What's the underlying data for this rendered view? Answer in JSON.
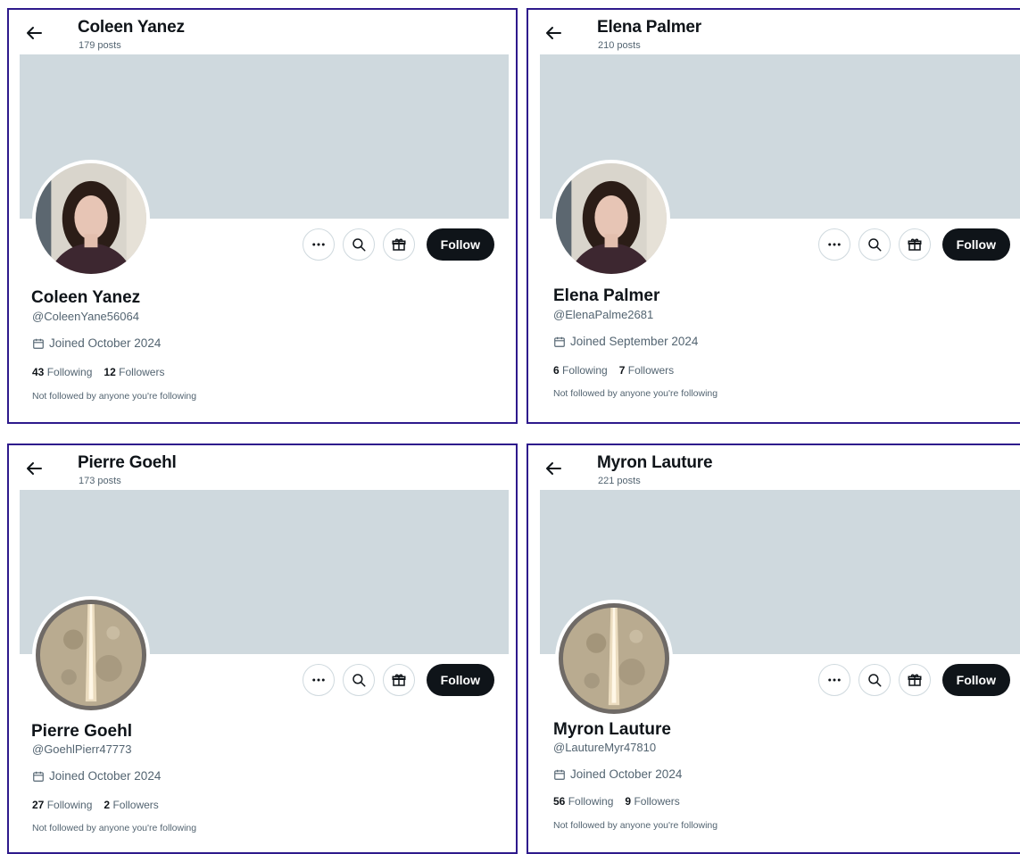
{
  "profiles": [
    {
      "header_name": "Coleen Yanez",
      "posts": "179 posts",
      "avatar_icon": "woman-portrait",
      "display_name": "Coleen Yanez",
      "handle": "@ColeenYane56064",
      "joined": "Joined October 2024",
      "following_count": "43",
      "following_label": "Following",
      "followers_count": "12",
      "followers_label": "Followers",
      "note": "Not followed by anyone you're following",
      "follow_label": "Follow"
    },
    {
      "header_name": "Elena Palmer",
      "posts": "210 posts",
      "avatar_icon": "woman-portrait",
      "display_name": "Elena Palmer",
      "handle": "@ElenaPalme2681",
      "joined": "Joined September 2024",
      "following_count": "6",
      "following_label": "Following",
      "followers_count": "7",
      "followers_label": "Followers",
      "note": "Not followed by anyone you're following",
      "follow_label": "Follow"
    },
    {
      "header_name": "Pierre Goehl",
      "posts": "173 posts",
      "avatar_icon": "moon-rocket",
      "display_name": "Pierre Goehl",
      "handle": "@GoehlPierr47773",
      "joined": "Joined October 2024",
      "following_count": "27",
      "following_label": "Following",
      "followers_count": "2",
      "followers_label": "Followers",
      "note": "Not followed by anyone you're following",
      "follow_label": "Follow"
    },
    {
      "header_name": "Myron Lauture",
      "posts": "221 posts",
      "avatar_icon": "moon-rocket",
      "display_name": "Myron Lauture",
      "handle": "@LautureMyr47810",
      "joined": "Joined October 2024",
      "following_count": "56",
      "following_label": "Following",
      "followers_count": "9",
      "followers_label": "Followers",
      "note": "Not followed by anyone you're following",
      "follow_label": "Follow"
    }
  ],
  "icons": {
    "back": "arrow-left-icon",
    "more": "more-icon",
    "search": "search-icon",
    "gift": "gift-icon",
    "calendar": "calendar-icon"
  },
  "colors": {
    "panel_border": "#2e1a8c",
    "banner": "#cfd9de",
    "follow_button": "#0f1419",
    "secondary_text": "#536471"
  }
}
